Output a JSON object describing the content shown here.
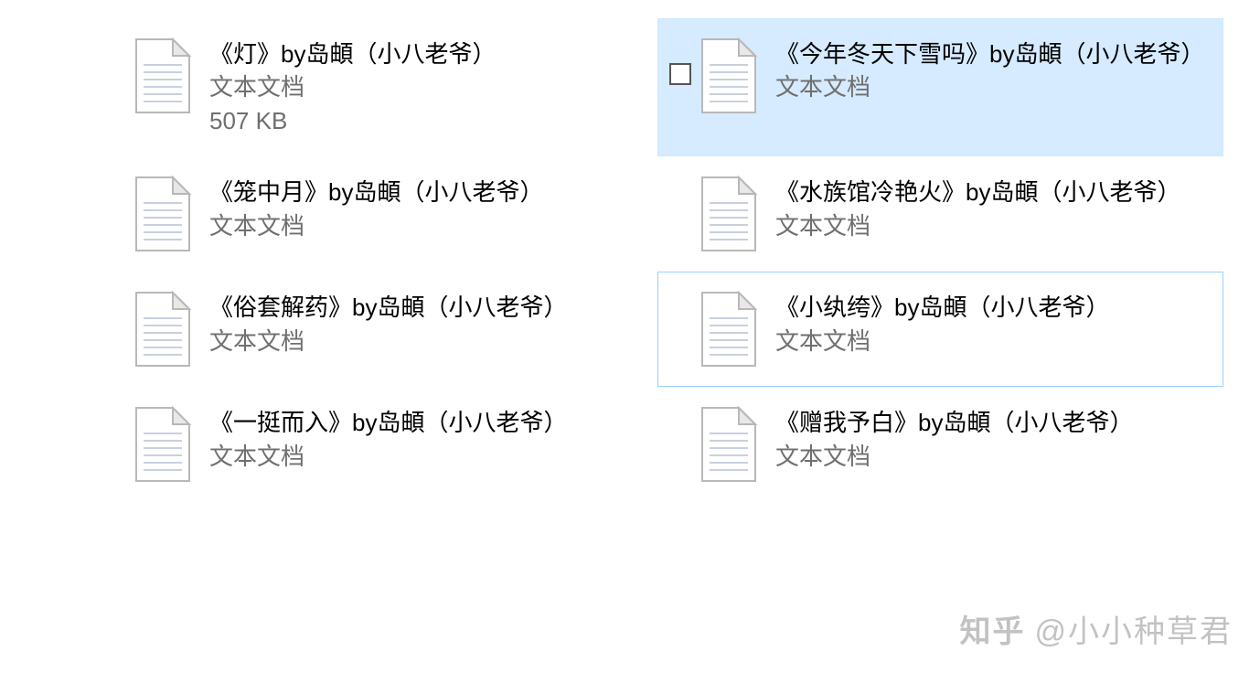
{
  "files": [
    {
      "name": "《灯》by岛頔（小八老爷）",
      "type": "文本文档",
      "size": "507 KB",
      "selected": false,
      "focused": false,
      "showCheckbox": false
    },
    {
      "name": "《今年冬天下雪吗》by岛頔（小八老爷）",
      "type": "文本文档",
      "size": "",
      "selected": true,
      "focused": false,
      "showCheckbox": true
    },
    {
      "name": "《笼中月》by岛頔（小八老爷）",
      "type": "文本文档",
      "size": "",
      "selected": false,
      "focused": false,
      "showCheckbox": false
    },
    {
      "name": "《水族馆冷艳火》by岛頔（小八老爷）",
      "type": "文本文档",
      "size": "",
      "selected": false,
      "focused": false,
      "showCheckbox": false
    },
    {
      "name": "《俗套解药》by岛頔（小八老爷）",
      "type": "文本文档",
      "size": "",
      "selected": false,
      "focused": false,
      "showCheckbox": false
    },
    {
      "name": "《小纨绔》by岛頔（小八老爷）",
      "type": "文本文档",
      "size": "",
      "selected": false,
      "focused": true,
      "showCheckbox": false
    },
    {
      "name": "《一挺而入》by岛頔（小八老爷）",
      "type": "文本文档",
      "size": "",
      "selected": false,
      "focused": false,
      "showCheckbox": false
    },
    {
      "name": "《赠我予白》by岛頔（小八老爷）",
      "type": "文本文档",
      "size": "",
      "selected": false,
      "focused": false,
      "showCheckbox": false
    }
  ],
  "watermark": {
    "logo": "知乎",
    "text": "@小小种草君"
  }
}
